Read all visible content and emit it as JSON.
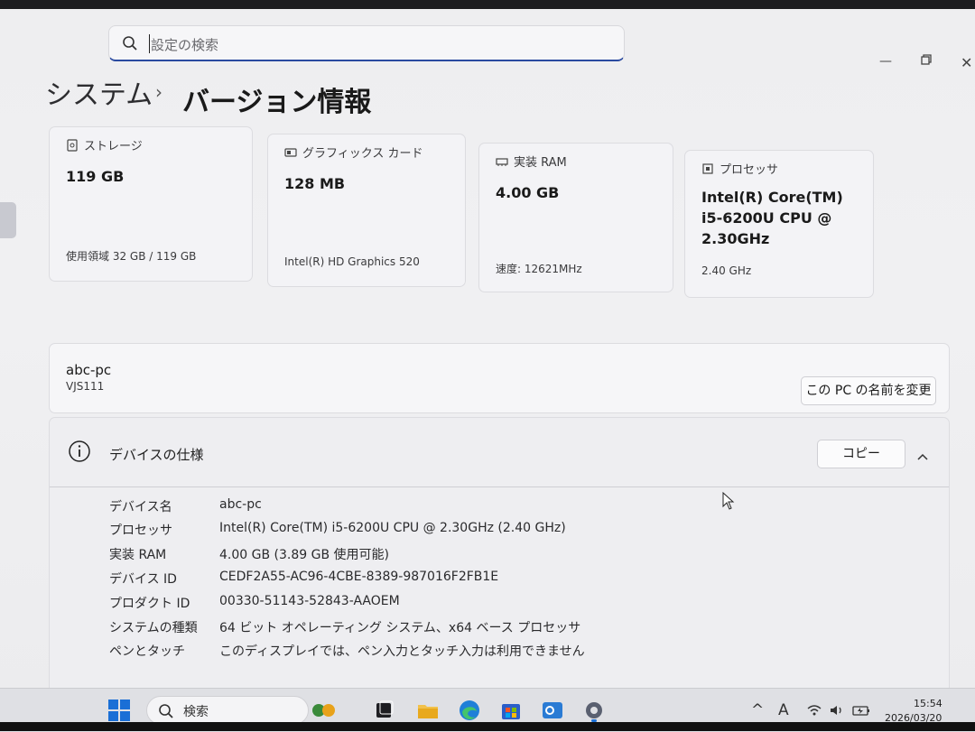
{
  "search": {
    "placeholder": "設定の検索"
  },
  "breadcrumb": {
    "parent": "システム",
    "separator": "›",
    "current": "バージョン情報"
  },
  "cards": [
    {
      "icon": "storage-icon",
      "title": "ストレージ",
      "value": "119 GB",
      "sub": "使用領域 32 GB / 119 GB"
    },
    {
      "icon": "graphics-card-icon",
      "title": "グラフィックス カード",
      "value": "128 MB",
      "sub": "Intel(R) HD Graphics 520"
    },
    {
      "icon": "ram-icon",
      "title": "実装 RAM",
      "value": "4.00 GB",
      "sub": "速度: 12621MHz"
    },
    {
      "icon": "processor-icon",
      "title": "プロセッサ",
      "value_lines": [
        "Intel(R) Core(TM)",
        "i5-6200U CPU @",
        "2.30GHz"
      ],
      "sub": "2.40 GHz"
    }
  ],
  "pc": {
    "name": "abc-pc",
    "model": "VJS111",
    "rename_button": "この PC の名前を変更"
  },
  "specs": {
    "title": "デバイスの仕様",
    "copy_button": "コピー",
    "rows": [
      {
        "key": "デバイス名",
        "value": "abc-pc"
      },
      {
        "key": "プロセッサ",
        "value": "Intel(R) Core(TM) i5-6200U CPU @ 2.30GHz (2.40 GHz)"
      },
      {
        "key": "実装 RAM",
        "value": "4.00 GB (3.89 GB 使用可能)"
      },
      {
        "key": "デバイス ID",
        "value": "CEDF2A55-AC96-4CBE-8389-987016F2FB1E"
      },
      {
        "key": "プロダクト ID",
        "value": "00330-51143-52843-AAOEM"
      },
      {
        "key": "システムの種類",
        "value": "64 ビット オペレーティング システム、x64 ベース プロセッサ"
      },
      {
        "key": "ペンとタッチ",
        "value": "このディスプレイでは、ペン入力とタッチ入力は利用できません"
      }
    ]
  },
  "taskbar": {
    "search_placeholder": "検索",
    "ime_indicator": "A",
    "time": "15:54",
    "date": "2026/03/20"
  },
  "colors": {
    "accent": "#2a4aa0",
    "start_blue": "#1a6fd6"
  }
}
